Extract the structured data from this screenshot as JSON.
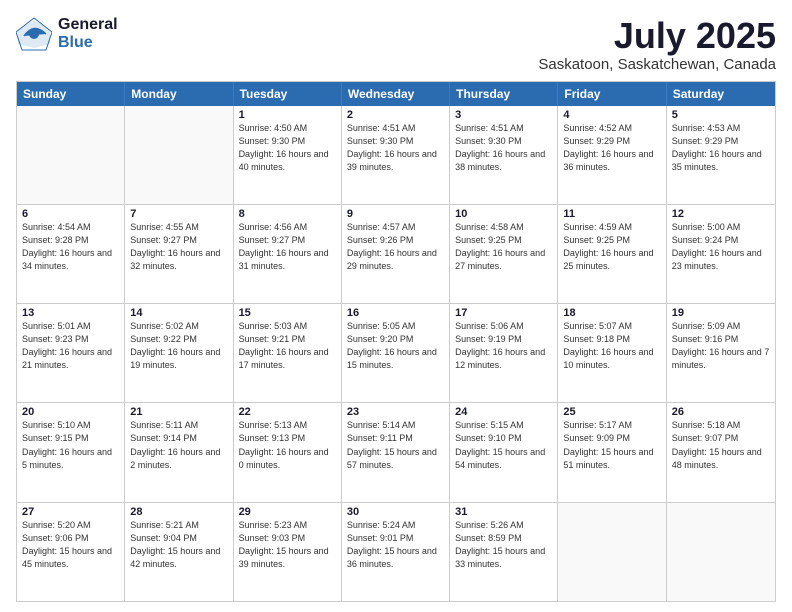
{
  "logo": {
    "general": "General",
    "blue": "Blue"
  },
  "title": "July 2025",
  "subtitle": "Saskatoon, Saskatchewan, Canada",
  "header_days": [
    "Sunday",
    "Monday",
    "Tuesday",
    "Wednesday",
    "Thursday",
    "Friday",
    "Saturday"
  ],
  "weeks": [
    [
      {
        "day": "",
        "info": ""
      },
      {
        "day": "",
        "info": ""
      },
      {
        "day": "1",
        "info": "Sunrise: 4:50 AM\nSunset: 9:30 PM\nDaylight: 16 hours\nand 40 minutes."
      },
      {
        "day": "2",
        "info": "Sunrise: 4:51 AM\nSunset: 9:30 PM\nDaylight: 16 hours\nand 39 minutes."
      },
      {
        "day": "3",
        "info": "Sunrise: 4:51 AM\nSunset: 9:30 PM\nDaylight: 16 hours\nand 38 minutes."
      },
      {
        "day": "4",
        "info": "Sunrise: 4:52 AM\nSunset: 9:29 PM\nDaylight: 16 hours\nand 36 minutes."
      },
      {
        "day": "5",
        "info": "Sunrise: 4:53 AM\nSunset: 9:29 PM\nDaylight: 16 hours\nand 35 minutes."
      }
    ],
    [
      {
        "day": "6",
        "info": "Sunrise: 4:54 AM\nSunset: 9:28 PM\nDaylight: 16 hours\nand 34 minutes."
      },
      {
        "day": "7",
        "info": "Sunrise: 4:55 AM\nSunset: 9:27 PM\nDaylight: 16 hours\nand 32 minutes."
      },
      {
        "day": "8",
        "info": "Sunrise: 4:56 AM\nSunset: 9:27 PM\nDaylight: 16 hours\nand 31 minutes."
      },
      {
        "day": "9",
        "info": "Sunrise: 4:57 AM\nSunset: 9:26 PM\nDaylight: 16 hours\nand 29 minutes."
      },
      {
        "day": "10",
        "info": "Sunrise: 4:58 AM\nSunset: 9:25 PM\nDaylight: 16 hours\nand 27 minutes."
      },
      {
        "day": "11",
        "info": "Sunrise: 4:59 AM\nSunset: 9:25 PM\nDaylight: 16 hours\nand 25 minutes."
      },
      {
        "day": "12",
        "info": "Sunrise: 5:00 AM\nSunset: 9:24 PM\nDaylight: 16 hours\nand 23 minutes."
      }
    ],
    [
      {
        "day": "13",
        "info": "Sunrise: 5:01 AM\nSunset: 9:23 PM\nDaylight: 16 hours\nand 21 minutes."
      },
      {
        "day": "14",
        "info": "Sunrise: 5:02 AM\nSunset: 9:22 PM\nDaylight: 16 hours\nand 19 minutes."
      },
      {
        "day": "15",
        "info": "Sunrise: 5:03 AM\nSunset: 9:21 PM\nDaylight: 16 hours\nand 17 minutes."
      },
      {
        "day": "16",
        "info": "Sunrise: 5:05 AM\nSunset: 9:20 PM\nDaylight: 16 hours\nand 15 minutes."
      },
      {
        "day": "17",
        "info": "Sunrise: 5:06 AM\nSunset: 9:19 PM\nDaylight: 16 hours\nand 12 minutes."
      },
      {
        "day": "18",
        "info": "Sunrise: 5:07 AM\nSunset: 9:18 PM\nDaylight: 16 hours\nand 10 minutes."
      },
      {
        "day": "19",
        "info": "Sunrise: 5:09 AM\nSunset: 9:16 PM\nDaylight: 16 hours\nand 7 minutes."
      }
    ],
    [
      {
        "day": "20",
        "info": "Sunrise: 5:10 AM\nSunset: 9:15 PM\nDaylight: 16 hours\nand 5 minutes."
      },
      {
        "day": "21",
        "info": "Sunrise: 5:11 AM\nSunset: 9:14 PM\nDaylight: 16 hours\nand 2 minutes."
      },
      {
        "day": "22",
        "info": "Sunrise: 5:13 AM\nSunset: 9:13 PM\nDaylight: 16 hours\nand 0 minutes."
      },
      {
        "day": "23",
        "info": "Sunrise: 5:14 AM\nSunset: 9:11 PM\nDaylight: 15 hours\nand 57 minutes."
      },
      {
        "day": "24",
        "info": "Sunrise: 5:15 AM\nSunset: 9:10 PM\nDaylight: 15 hours\nand 54 minutes."
      },
      {
        "day": "25",
        "info": "Sunrise: 5:17 AM\nSunset: 9:09 PM\nDaylight: 15 hours\nand 51 minutes."
      },
      {
        "day": "26",
        "info": "Sunrise: 5:18 AM\nSunset: 9:07 PM\nDaylight: 15 hours\nand 48 minutes."
      }
    ],
    [
      {
        "day": "27",
        "info": "Sunrise: 5:20 AM\nSunset: 9:06 PM\nDaylight: 15 hours\nand 45 minutes."
      },
      {
        "day": "28",
        "info": "Sunrise: 5:21 AM\nSunset: 9:04 PM\nDaylight: 15 hours\nand 42 minutes."
      },
      {
        "day": "29",
        "info": "Sunrise: 5:23 AM\nSunset: 9:03 PM\nDaylight: 15 hours\nand 39 minutes."
      },
      {
        "day": "30",
        "info": "Sunrise: 5:24 AM\nSunset: 9:01 PM\nDaylight: 15 hours\nand 36 minutes."
      },
      {
        "day": "31",
        "info": "Sunrise: 5:26 AM\nSunset: 8:59 PM\nDaylight: 15 hours\nand 33 minutes."
      },
      {
        "day": "",
        "info": ""
      },
      {
        "day": "",
        "info": ""
      }
    ]
  ]
}
